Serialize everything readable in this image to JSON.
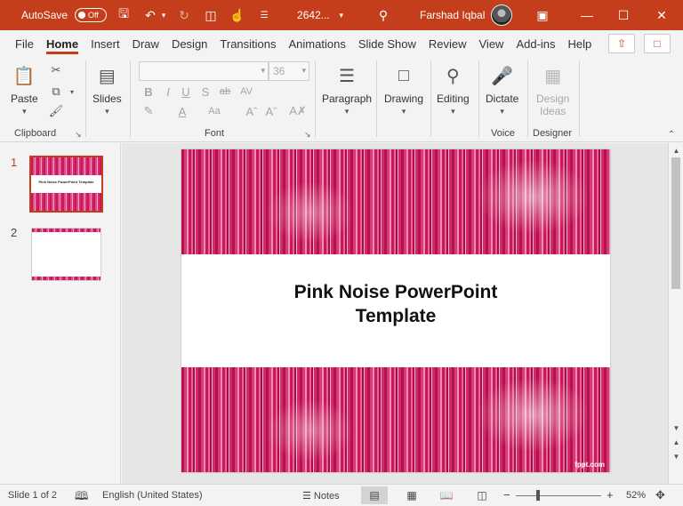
{
  "titlebar": {
    "autosave_label": "AutoSave",
    "toggle_state": "Off",
    "doc_title": "2642...",
    "user_name": "Farshad Iqbal",
    "accent_color": "#c43e1c"
  },
  "tabs": [
    "File",
    "Home",
    "Insert",
    "Draw",
    "Design",
    "Transitions",
    "Animations",
    "Slide Show",
    "Review",
    "View",
    "Add-ins",
    "Help"
  ],
  "active_tab": "Home",
  "ribbon": {
    "paste_label": "Paste",
    "slides_label": "Slides",
    "font_size_placeholder": "36",
    "paragraph_label": "Paragraph",
    "drawing_label": "Drawing",
    "editing_label": "Editing",
    "dictate_label": "Dictate",
    "design_ideas_label_1": "Design",
    "design_ideas_label_2": "Ideas",
    "groups": {
      "clipboard": "Clipboard",
      "font": "Font",
      "voice": "Voice",
      "designer": "Designer"
    }
  },
  "thumbnails": [
    {
      "number": "1",
      "title": "Pink Noise PowerPoint Template",
      "active": true
    },
    {
      "number": "2",
      "title": "",
      "active": false
    }
  ],
  "slide": {
    "title_line1": "Pink Noise PowerPoint",
    "title_line2": "Template",
    "watermark": "fppt.com",
    "band_color": "#d63a78"
  },
  "statusbar": {
    "slide_info": "Slide 1 of 2",
    "language": "English (United States)",
    "notes_label": "Notes",
    "zoom_percent": "52%",
    "zoom_value": 52
  }
}
